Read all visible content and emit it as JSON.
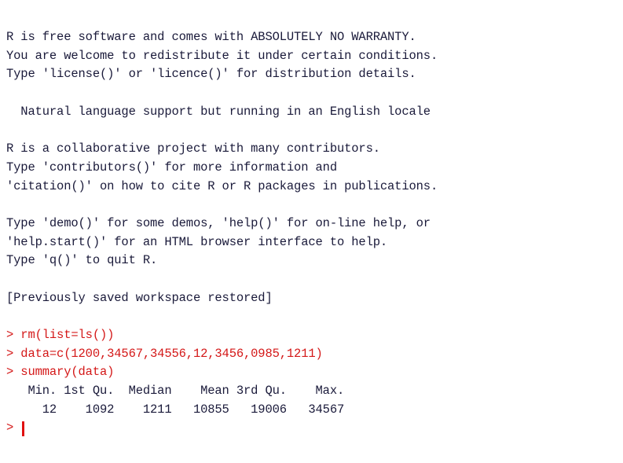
{
  "console": {
    "banner": [
      "R is free software and comes with ABSOLUTELY NO WARRANTY.",
      "You are welcome to redistribute it under certain conditions.",
      "Type 'license()' or 'licence()' for distribution details.",
      "",
      "  Natural language support but running in an English locale",
      "",
      "R is a collaborative project with many contributors.",
      "Type 'contributors()' for more information and",
      "'citation()' on how to cite R or R packages in publications.",
      "",
      "Type 'demo()' for some demos, 'help()' for on-line help, or",
      "'help.start()' for an HTML browser interface to help.",
      "Type 'q()' to quit R.",
      "",
      "[Previously saved workspace restored]",
      ""
    ],
    "commands": [
      "> rm(list=ls())",
      "> data=c(1200,34567,34556,12,3456,0985,1211)",
      "> summary(data)"
    ],
    "summary_header": "   Min. 1st Qu.  Median    Mean 3rd Qu.    Max. ",
    "summary_values": "     12    1092    1211   10855   19006   34567 ",
    "prompt": "> "
  },
  "colors": {
    "output_text": "#1a1a3a",
    "input_text": "#d41818",
    "cursor": "#e01010",
    "background": "#ffffff"
  }
}
